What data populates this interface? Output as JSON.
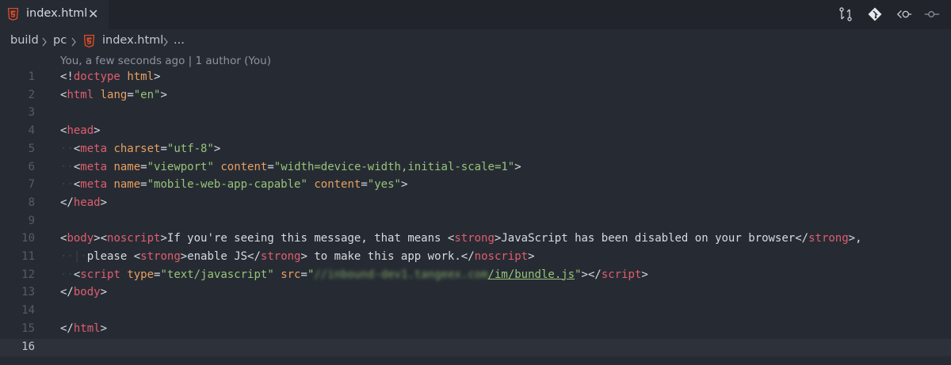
{
  "tab": {
    "filename": "index.html",
    "close_glyph": "✕",
    "icon": "html5-icon"
  },
  "toolbar": {
    "icons": [
      "compare-changes-icon",
      "git-icon",
      "go-back-icon",
      "commit-icon"
    ]
  },
  "breadcrumb": {
    "items": [
      "build",
      "pc",
      "index.html",
      "..."
    ]
  },
  "blame": {
    "text": "You, a few seconds ago | 1 author (You)"
  },
  "editor": {
    "current_line": 16,
    "line_numbers": [
      "1",
      "2",
      "3",
      "4",
      "5",
      "6",
      "7",
      "8",
      "9",
      "10",
      "11",
      "12",
      "13",
      "14",
      "15",
      "16"
    ],
    "lines": [
      [
        [
          "p",
          "<!"
        ],
        [
          "t",
          "doctype"
        ],
        [
          "p",
          " "
        ],
        [
          "a",
          "html"
        ],
        [
          "p",
          ">"
        ]
      ],
      [
        [
          "p",
          "<"
        ],
        [
          "t",
          "html"
        ],
        [
          "p",
          " "
        ],
        [
          "a",
          "lang"
        ],
        [
          "p",
          "="
        ],
        [
          "s",
          "\"en\""
        ],
        [
          "p",
          ">"
        ]
      ],
      [],
      [
        [
          "p",
          "<"
        ],
        [
          "t",
          "head"
        ],
        [
          "p",
          ">"
        ]
      ],
      [
        [
          "ws",
          "··"
        ],
        [
          "p",
          "<"
        ],
        [
          "t",
          "meta"
        ],
        [
          "p",
          " "
        ],
        [
          "a",
          "charset"
        ],
        [
          "p",
          "="
        ],
        [
          "s",
          "\"utf-8\""
        ],
        [
          "p",
          ">"
        ]
      ],
      [
        [
          "ws",
          "··"
        ],
        [
          "p",
          "<"
        ],
        [
          "t",
          "meta"
        ],
        [
          "p",
          " "
        ],
        [
          "a",
          "name"
        ],
        [
          "p",
          "="
        ],
        [
          "s",
          "\"viewport\""
        ],
        [
          "p",
          " "
        ],
        [
          "a",
          "content"
        ],
        [
          "p",
          "="
        ],
        [
          "s",
          "\"width=device-width,initial-scale=1\""
        ],
        [
          "p",
          ">"
        ]
      ],
      [
        [
          "ws",
          "··"
        ],
        [
          "p",
          "<"
        ],
        [
          "t",
          "meta"
        ],
        [
          "p",
          " "
        ],
        [
          "a",
          "name"
        ],
        [
          "p",
          "="
        ],
        [
          "s",
          "\"mobile-web-app-capable\""
        ],
        [
          "p",
          " "
        ],
        [
          "a",
          "content"
        ],
        [
          "p",
          "="
        ],
        [
          "s",
          "\"yes\""
        ],
        [
          "p",
          ">"
        ]
      ],
      [
        [
          "p",
          "</"
        ],
        [
          "t",
          "head"
        ],
        [
          "p",
          ">"
        ]
      ],
      [],
      [
        [
          "p",
          "<"
        ],
        [
          "t",
          "body"
        ],
        [
          "p",
          "><"
        ],
        [
          "t",
          "noscript"
        ],
        [
          "p",
          ">"
        ],
        [
          "tx",
          "If you're seeing this message, that means "
        ],
        [
          "p",
          "<"
        ],
        [
          "t",
          "strong"
        ],
        [
          "p",
          ">"
        ],
        [
          "tx",
          "JavaScript has been disabled on your browser"
        ],
        [
          "p",
          "</"
        ],
        [
          "t",
          "strong"
        ],
        [
          "p",
          ">"
        ],
        [
          "tx",
          ","
        ]
      ],
      [
        [
          "ws",
          "··|·"
        ],
        [
          "tx",
          "please "
        ],
        [
          "p",
          "<"
        ],
        [
          "t",
          "strong"
        ],
        [
          "p",
          ">"
        ],
        [
          "tx",
          "enable JS"
        ],
        [
          "p",
          "</"
        ],
        [
          "t",
          "strong"
        ],
        [
          "p",
          ">"
        ],
        [
          "tx",
          " to make this app work."
        ],
        [
          "p",
          "</"
        ],
        [
          "t",
          "noscript"
        ],
        [
          "p",
          ">"
        ]
      ],
      [
        [
          "ws",
          "··"
        ],
        [
          "p",
          "<"
        ],
        [
          "t",
          "script"
        ],
        [
          "p",
          " "
        ],
        [
          "a",
          "type"
        ],
        [
          "p",
          "="
        ],
        [
          "s",
          "\"text/javascript\""
        ],
        [
          "p",
          " "
        ],
        [
          "a",
          "src"
        ],
        [
          "p",
          "="
        ],
        [
          "s",
          "\""
        ],
        [
          "blur",
          "//inbound-dev1.tangeex.com"
        ],
        [
          "u",
          "/im/bundle.js"
        ],
        [
          "s",
          "\""
        ],
        [
          "p",
          "></"
        ],
        [
          "t",
          "script"
        ],
        [
          "p",
          ">"
        ]
      ],
      [
        [
          "p",
          "</"
        ],
        [
          "t",
          "body"
        ],
        [
          "p",
          ">"
        ]
      ],
      [],
      [
        [
          "p",
          "</"
        ],
        [
          "t",
          "html"
        ],
        [
          "p",
          ">"
        ]
      ],
      []
    ]
  },
  "colors": {
    "background": "#262b33",
    "tag": "#e05d6f",
    "attribute": "#e8a060",
    "string": "#98c379",
    "text": "#d7dae0",
    "html5": "#e44d26"
  }
}
